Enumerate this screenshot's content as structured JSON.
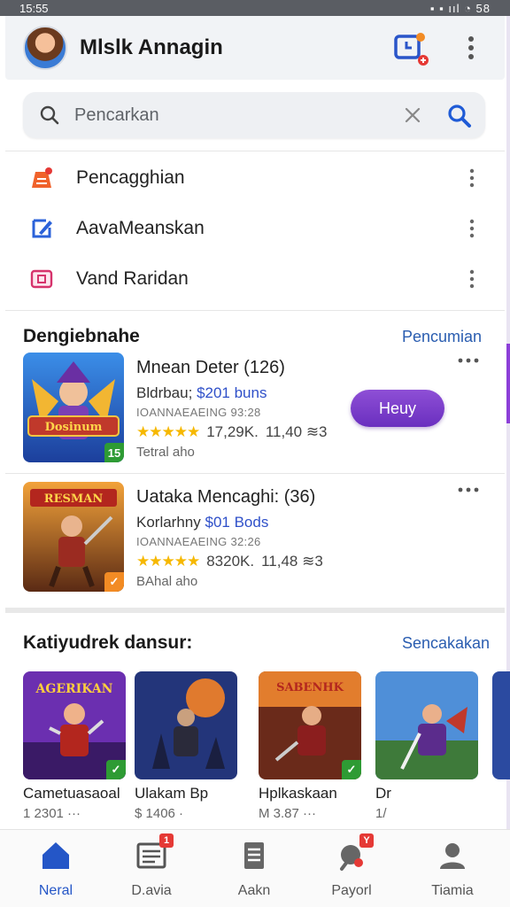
{
  "status_bar": {
    "time": "15:55",
    "right": "▪ ▪ ııl ◔ 58"
  },
  "header": {
    "title": "Mlslk Annagin",
    "calendar_icon": "calendar-clock-icon",
    "more_icon": "more-vert-icon"
  },
  "search": {
    "placeholder": "Pencarkan",
    "value": ""
  },
  "menu": {
    "items": [
      {
        "label": "Pencagghian",
        "icon": "notebook-icon",
        "color": "#f0622b"
      },
      {
        "label": "AavaMeanskan",
        "icon": "refresh-edit-icon",
        "color": "#2b62d9"
      },
      {
        "label": "Vand Raridan",
        "icon": "clipboard-icon",
        "color": "#d6336c"
      }
    ]
  },
  "section1": {
    "title": "Dengiebnahe",
    "link": "Pencumian",
    "cards": [
      {
        "name": "Mnean Deter (126)",
        "price_prefix": "Bldrbau;",
        "price": "$201 buns",
        "sub": "IOANNAEAEING 93:28",
        "stars": "★★★★★",
        "rating": "17,29K.",
        "count": "11,40 ≋3",
        "tag": "Tetral aho",
        "badge": "15",
        "badge_color": "#2e9b34",
        "action": "Heuy"
      },
      {
        "name": "Uataka Mencaghi: (36)",
        "price_prefix": "Korlarhny",
        "price": "$01 Bods",
        "sub": "IOANNAEAEING 32:26",
        "stars": "★★★★★",
        "rating": "8320K.",
        "count": "11,48 ≋3",
        "tag": "BAhal aho",
        "badge": "✓",
        "badge_color": "#f28b24"
      }
    ]
  },
  "section2": {
    "title": "Katiyudrek dansur:",
    "link": "Sencakakan",
    "tiles": [
      {
        "name": "Cametuasaoal",
        "meta": "1 2301 ···",
        "banner": "AGERIKAN",
        "badge": "✓"
      },
      {
        "name": "Ulakam Bp",
        "meta": "$ 1406 ·",
        "banner": ""
      },
      {
        "name": "Hplkaskaan",
        "meta": "M 3.87 ···",
        "banner": "SABENHK",
        "badge": "✓"
      },
      {
        "name": "Dr",
        "meta": "1/",
        "banner": ""
      }
    ]
  },
  "bottom_nav": {
    "items": [
      {
        "label": "Neral",
        "icon": "home-icon",
        "active": true
      },
      {
        "label": "D.avia",
        "icon": "news-icon",
        "badge": "1"
      },
      {
        "label": "Aakn",
        "icon": "document-icon"
      },
      {
        "label": "Payorl",
        "icon": "search-tag-icon",
        "badge": "Y"
      },
      {
        "label": "Tiamia",
        "icon": "person-icon"
      }
    ]
  },
  "colors": {
    "accent": "#2456c7",
    "buy_button": "#7a3ccb",
    "star": "#f6b800"
  }
}
